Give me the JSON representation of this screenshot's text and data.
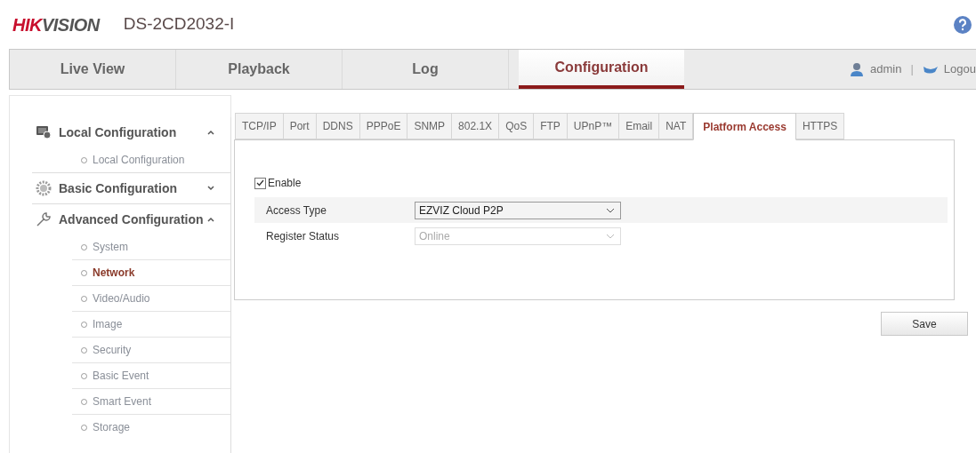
{
  "header": {
    "logo": {
      "red_part": "HIK",
      "gray_part": "VISION"
    },
    "model": "DS-2CD2032-I"
  },
  "nav": {
    "tabs": [
      {
        "label": "Live View",
        "selected": false
      },
      {
        "label": "Playback",
        "selected": false
      },
      {
        "label": "Log",
        "selected": false
      },
      {
        "label": "Configuration",
        "selected": true
      }
    ],
    "user": "admin",
    "separator": "|",
    "logout": "Logou"
  },
  "sidebar": {
    "groups": [
      {
        "label": "Local Configuration",
        "kind": "monitor",
        "expanded": true,
        "items": [
          {
            "label": "Local Configuration",
            "selected": false
          }
        ]
      },
      {
        "label": "Basic Configuration",
        "kind": "gear",
        "expanded": false
      },
      {
        "label": "Advanced Configuration",
        "kind": "wrench",
        "expanded": true,
        "items": [
          {
            "label": "System",
            "selected": false
          },
          {
            "label": "Network",
            "selected": true
          },
          {
            "label": "Video/Audio",
            "selected": false
          },
          {
            "label": "Image",
            "selected": false
          },
          {
            "label": "Security",
            "selected": false
          },
          {
            "label": "Basic Event",
            "selected": false
          },
          {
            "label": "Smart Event",
            "selected": false
          },
          {
            "label": "Storage",
            "selected": false
          }
        ]
      }
    ]
  },
  "tabs": [
    {
      "label": "TCP/IP",
      "selected": false
    },
    {
      "label": "Port",
      "selected": false
    },
    {
      "label": "DDNS",
      "selected": false
    },
    {
      "label": "PPPoE",
      "selected": false
    },
    {
      "label": "SNMP",
      "selected": false
    },
    {
      "label": "802.1X",
      "selected": false
    },
    {
      "label": "QoS",
      "selected": false
    },
    {
      "label": "FTP",
      "selected": false
    },
    {
      "label": "UPnP™",
      "selected": false
    },
    {
      "label": "Email",
      "selected": false
    },
    {
      "label": "NAT",
      "selected": false
    },
    {
      "label": "Platform Access",
      "selected": true
    },
    {
      "label": "HTTPS",
      "selected": false
    }
  ],
  "form": {
    "enable": {
      "label": "Enable",
      "checked": true
    },
    "fields": [
      {
        "label": "Access Type",
        "value": "EZVIZ Cloud P2P",
        "disabled": false
      },
      {
        "label": "Register Status",
        "value": "Online",
        "disabled": true
      }
    ]
  },
  "save_button": "Save"
}
